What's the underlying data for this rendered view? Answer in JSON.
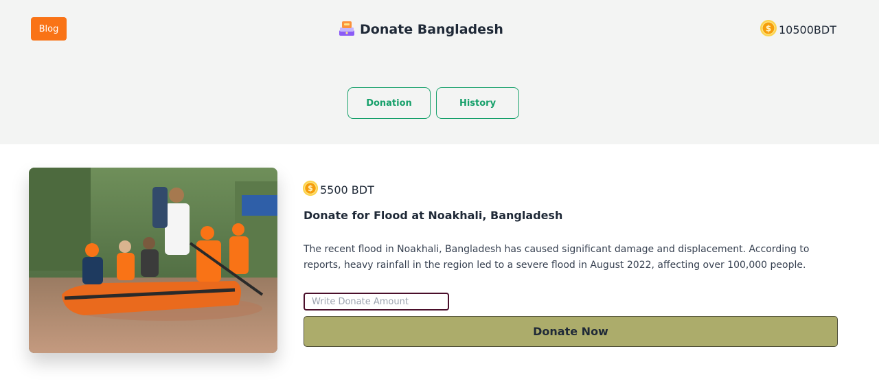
{
  "header": {
    "blog_label": "Blog",
    "brand_icon": "donation-box-icon",
    "title": "Donate Bangladesh",
    "balance": "10500BDT",
    "balance_icon": "coin-icon"
  },
  "tabs": [
    {
      "label": "Donation"
    },
    {
      "label": "History"
    }
  ],
  "donation_card": {
    "image_alt": "Rescue workers in an orange inflatable boat on a flooded street",
    "amount_icon": "coin-icon",
    "amount": "5500 BDT",
    "title": "Donate for Flood at Noakhali, Bangladesh",
    "description": "The recent flood in Noakhali, Bangladesh has caused significant damage and displacement. According to reports, heavy rainfall in the region led to a severe flood in August 2022, affecting over 100,000 people.",
    "input_placeholder": "Write Donate Amount",
    "input_value": "",
    "button_label": "Donate Now"
  },
  "colors": {
    "accent_orange": "#f97316",
    "tab_green": "#16a06a",
    "donate_button": "#acac6b",
    "hero_background": "#f3f4f3"
  }
}
